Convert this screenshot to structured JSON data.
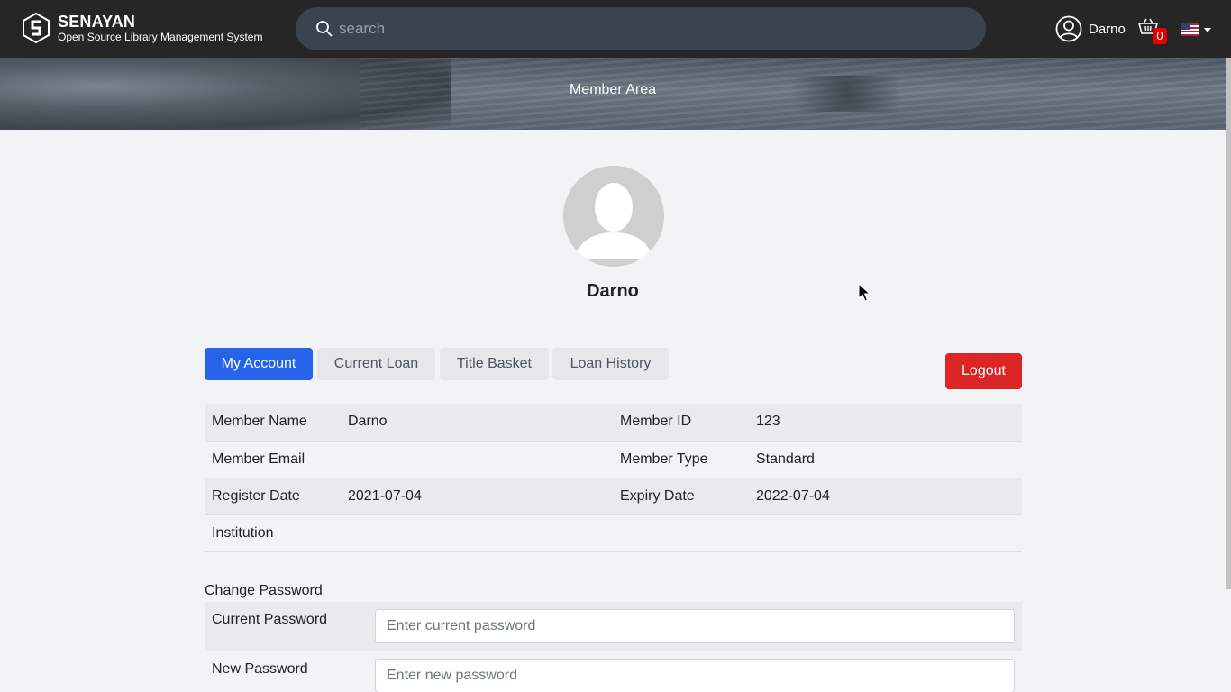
{
  "navbar": {
    "brand_title": "SENAYAN",
    "brand_subtitle": "Open Source Library Management System",
    "search_placeholder": "search",
    "user_name": "Darno",
    "cart_count": "0"
  },
  "banner": {
    "title": "Member Area"
  },
  "profile": {
    "name": "Darno"
  },
  "tabs": [
    {
      "label": "My Account",
      "active": true
    },
    {
      "label": "Current Loan",
      "active": false
    },
    {
      "label": "Title Basket",
      "active": false
    },
    {
      "label": "Loan History",
      "active": false
    }
  ],
  "logout_label": "Logout",
  "member_info": [
    {
      "label1": "Member Name",
      "value1": "Darno",
      "label2": "Member ID",
      "value2": "123"
    },
    {
      "label1": "Member Email",
      "value1": "",
      "label2": "Member Type",
      "value2": "Standard"
    },
    {
      "label1": "Register Date",
      "value1": "2021-07-04",
      "label2": "Expiry Date",
      "value2": "2022-07-04"
    },
    {
      "label1": "Institution",
      "value1": "",
      "label2": "",
      "value2": ""
    }
  ],
  "change_password": {
    "title": "Change Password",
    "fields": [
      {
        "label": "Current Password",
        "placeholder": "Enter current password"
      },
      {
        "label": "New Password",
        "placeholder": "Enter new password"
      }
    ]
  },
  "colors": {
    "navbar_bg": "#262626",
    "accent": "#2563eb",
    "danger": "#dc2626",
    "cart_badge": "#e60000"
  },
  "icons": [
    "logo-icon",
    "search-icon",
    "user-icon",
    "cart-icon",
    "us-flag-icon",
    "caret-down-icon",
    "avatar-placeholder-icon"
  ]
}
